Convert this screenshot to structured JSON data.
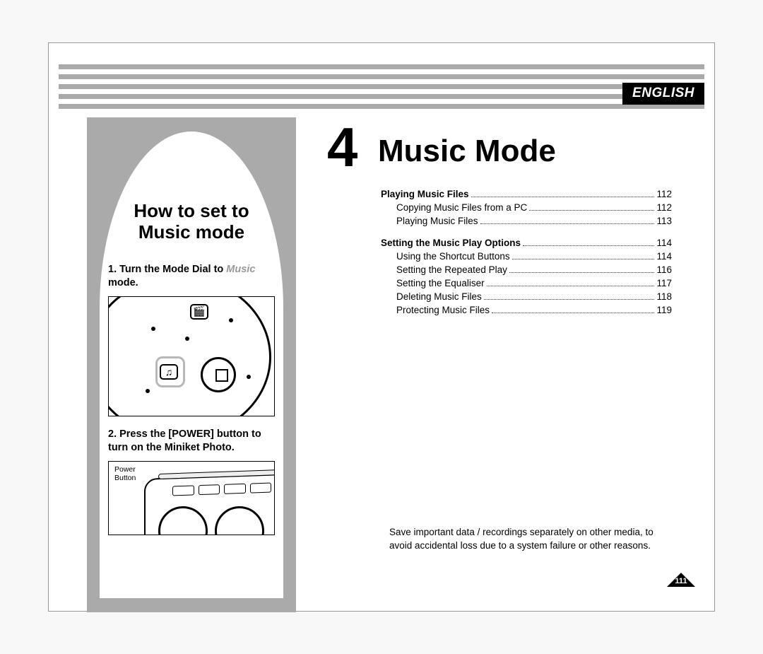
{
  "language_label": "ENGLISH",
  "chapter": {
    "number": "4",
    "title": "Music Mode"
  },
  "sidebar": {
    "heading_line1": "How to set to",
    "heading_line2": "Music mode",
    "step1_prefix": "1. Turn the Mode Dial to ",
    "step1_italic": "Music",
    "step1_suffix": " mode.",
    "dial_music_glyph": "♫",
    "dial_video_glyph": "🎬",
    "step2": "2. Press the [POWER] button to turn on the Miniket Photo.",
    "power_label_line1": "Power",
    "power_label_line2": "Button"
  },
  "toc": [
    {
      "label": "Playing Music Files",
      "page": "112",
      "bold": true,
      "indent": false
    },
    {
      "label": "Copying Music Files from a PC",
      "page": "112",
      "bold": false,
      "indent": true
    },
    {
      "label": "Playing Music Files",
      "page": "113",
      "bold": false,
      "indent": true
    },
    {
      "gap": true
    },
    {
      "label": "Setting the Music Play Options",
      "page": "114",
      "bold": true,
      "indent": false
    },
    {
      "label": "Using the Shortcut Buttons",
      "page": "114",
      "bold": false,
      "indent": true
    },
    {
      "label": "Setting the Repeated Play",
      "page": "116",
      "bold": false,
      "indent": true
    },
    {
      "label": "Setting the Equaliser",
      "page": "117",
      "bold": false,
      "indent": true
    },
    {
      "label": "Deleting Music Files",
      "page": "118",
      "bold": false,
      "indent": true
    },
    {
      "label": "Protecting Music Files",
      "page": "119",
      "bold": false,
      "indent": true
    }
  ],
  "footnote": "Save important data / recordings separately on other media, to avoid accidental loss due to a system failure or other reasons.",
  "page_number": "111"
}
